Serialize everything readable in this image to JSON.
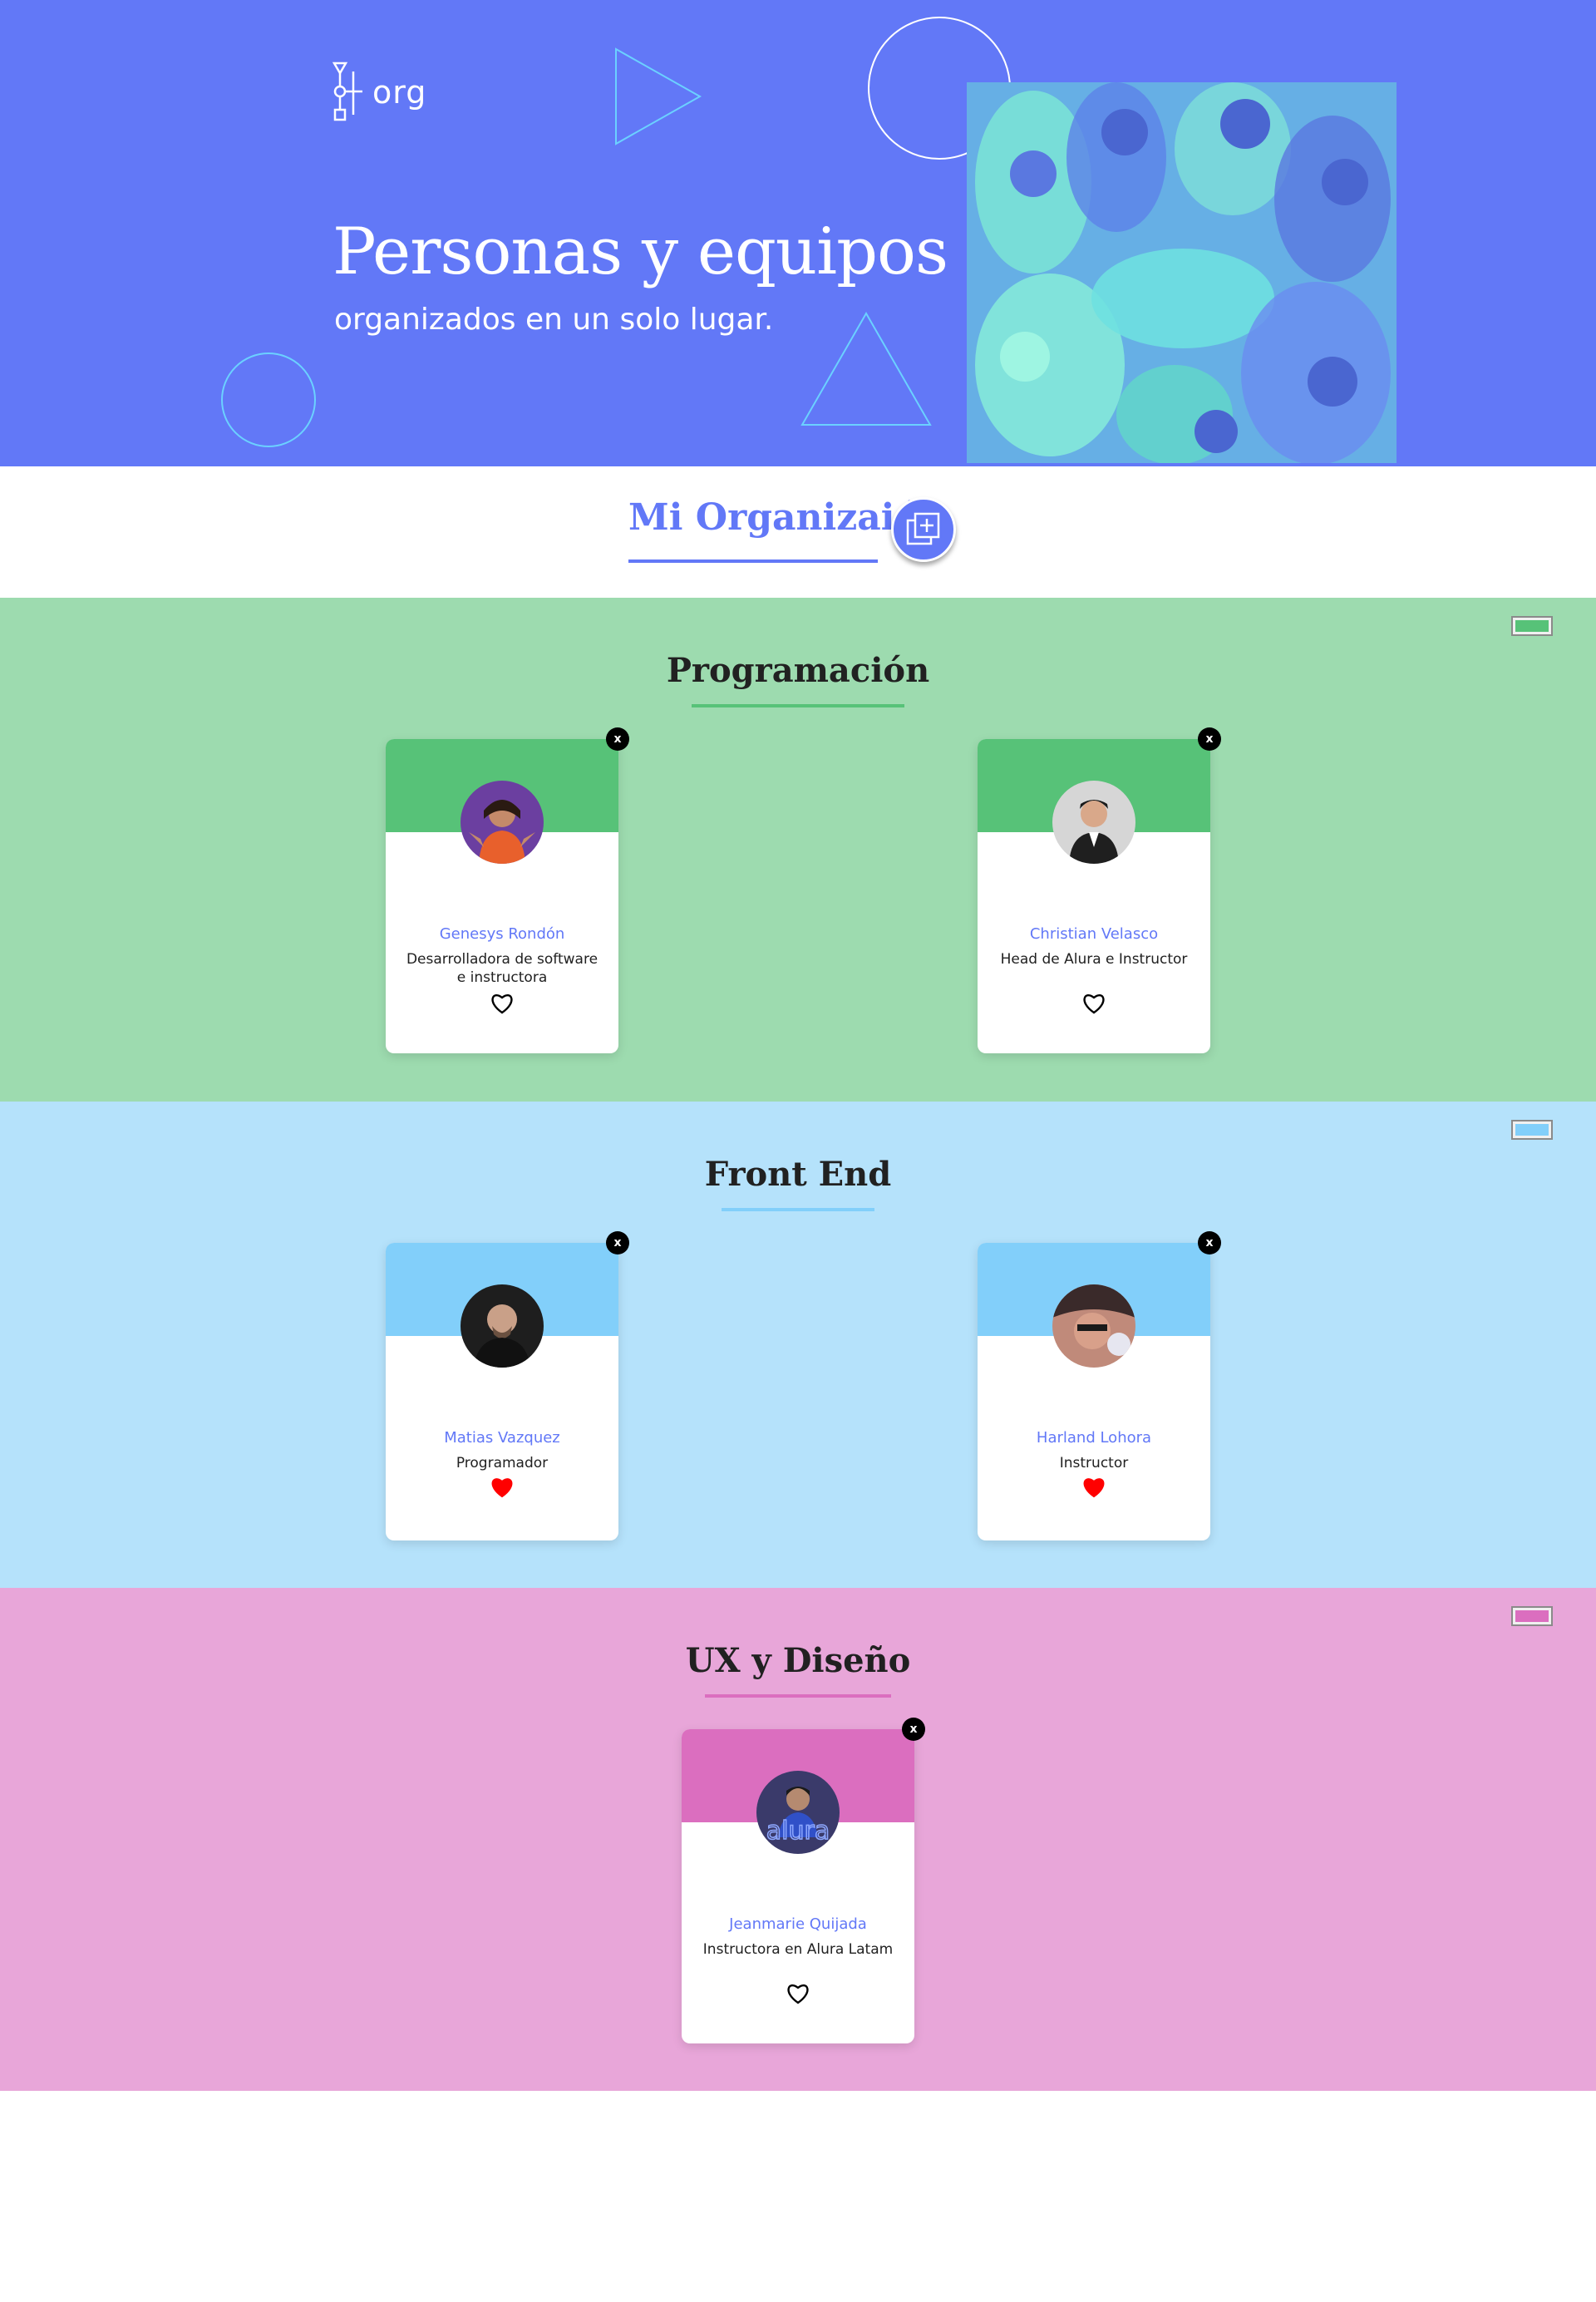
{
  "header": {
    "logo_text": "org",
    "title": "Personas y equipos",
    "subtitle": "organizados en un solo lugar."
  },
  "organization": {
    "title": "Mi Organizaión",
    "add_button_icon": "add-team-icon"
  },
  "teams": [
    {
      "name": "Programación",
      "primary_color": "#57c278",
      "secondary_color": "#9ddbaf",
      "members": [
        {
          "name": "Genesys Rondón",
          "role": "Desarrolladora de software e instructora",
          "favorite": false
        },
        {
          "name": "Christian Velasco",
          "role": "Head de Alura e Instructor",
          "favorite": false
        }
      ]
    },
    {
      "name": "Front End",
      "primary_color": "#82cffa",
      "secondary_color": "#b5e2fb",
      "members": [
        {
          "name": "Matias Vazquez",
          "role": "Programador",
          "favorite": true
        },
        {
          "name": "Harland Lohora",
          "role": "Instructor",
          "favorite": true
        }
      ]
    },
    {
      "name": "UX y Diseño",
      "primary_color": "#db6ebf",
      "secondary_color": "#e8a6d9",
      "members": [
        {
          "name": "Jeanmarie Quijada",
          "role": "Instructora en Alura Latam",
          "favorite": false
        }
      ]
    }
  ],
  "card_close_label": "x",
  "colors": {
    "brand": "#6278f7",
    "accent_teal": "#6bd1ff",
    "heart_filled": "#ff0000"
  }
}
